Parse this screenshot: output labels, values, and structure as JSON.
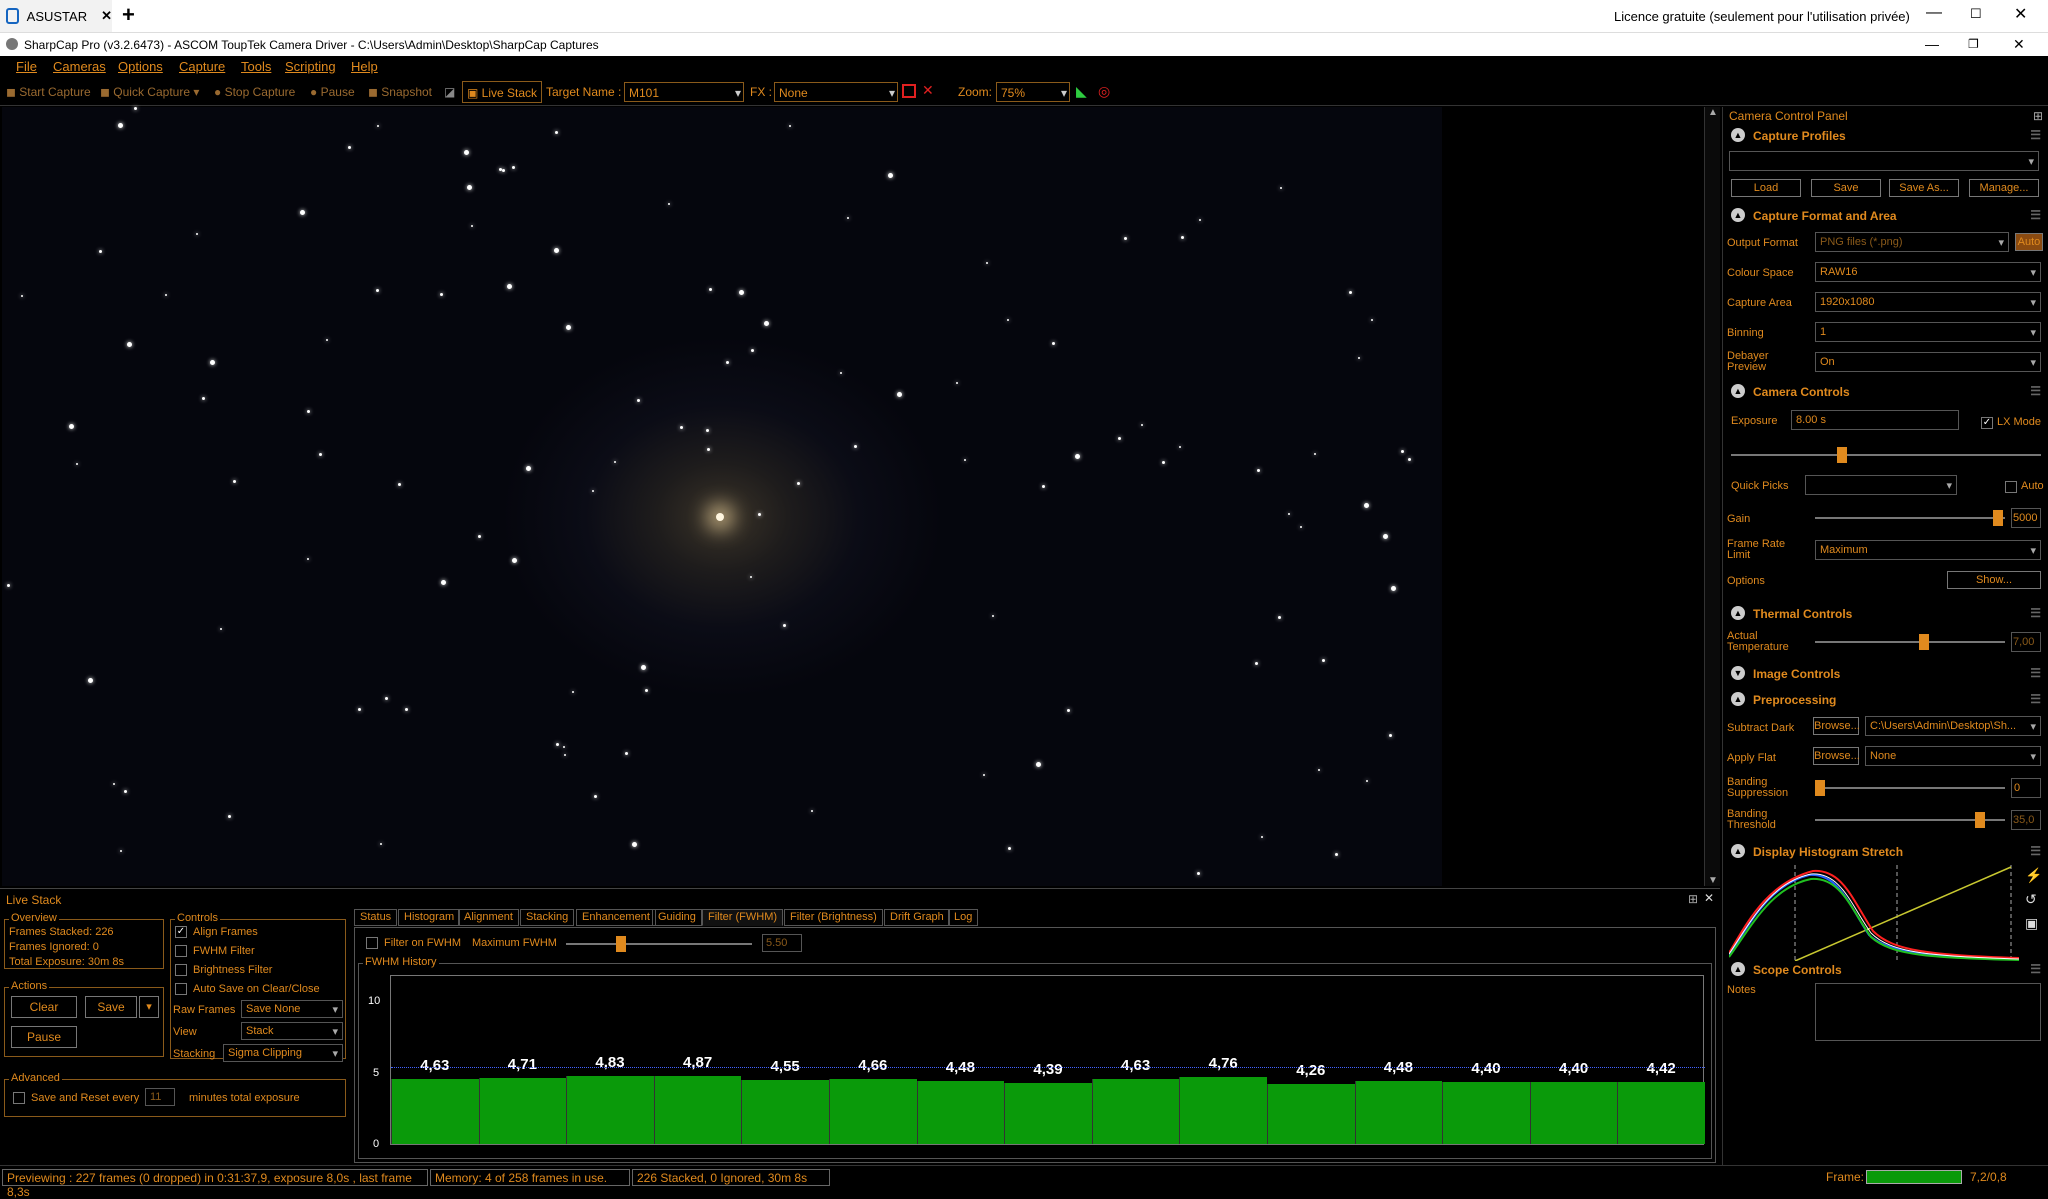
{
  "browser": {
    "tab_label": "ASUSTAR",
    "licence": "Licence gratuite (seulement pour l'utilisation privée)"
  },
  "window": {
    "title": "SharpCap Pro (v3.2.6473) - ASCOM ToupTek Camera Driver - C:\\Users\\Admin\\Desktop\\SharpCap Captures"
  },
  "menu": [
    "File",
    "Cameras",
    "Options",
    "Capture",
    "Tools",
    "Scripting",
    "Help"
  ],
  "toolbar": {
    "start_capture": "Start Capture",
    "quick_capture": "Quick Capture",
    "stop_capture": "Stop Capture",
    "pause": "Pause",
    "snapshot": "Snapshot",
    "live_stack": "Live Stack",
    "target_label": "Target Name :",
    "target_value": "M101",
    "fx_label": "FX :",
    "fx_value": "None",
    "zoom_label": "Zoom:",
    "zoom_value": "75%"
  },
  "right_panel": {
    "title": "Camera Control Panel",
    "capture_profiles": {
      "header": "Capture Profiles",
      "load": "Load",
      "save": "Save",
      "save_as": "Save As...",
      "manage": "Manage..."
    },
    "format": {
      "header": "Capture Format and Area",
      "output_format_label": "Output Format",
      "output_format": "PNG files (*.png)",
      "auto": "Auto",
      "colour_space_label": "Colour Space",
      "colour_space": "RAW16",
      "capture_area_label": "Capture Area",
      "capture_area": "1920x1080",
      "binning_label": "Binning",
      "binning": "1",
      "debayer_label": "Debayer Preview",
      "debayer": "On"
    },
    "camera": {
      "header": "Camera Controls",
      "exposure_label": "Exposure",
      "exposure": "8.00 s",
      "lx_mode": "LX Mode",
      "quick_picks_label": "Quick Picks",
      "quick_auto": "Auto",
      "gain_label": "Gain",
      "gain": "5000",
      "frame_rate_label": "Frame Rate Limit",
      "frame_rate": "Maximum",
      "options_label": "Options",
      "show": "Show..."
    },
    "thermal": {
      "header": "Thermal Controls",
      "temp_label": "Actual Temperature",
      "temp": "7,00"
    },
    "image_controls": {
      "header": "Image Controls"
    },
    "preprocessing": {
      "header": "Preprocessing",
      "dark_label": "Subtract Dark",
      "browse": "Browse...",
      "dark_path": "C:\\Users\\Admin\\Desktop\\Sh...",
      "flat_label": "Apply Flat",
      "flat": "None",
      "banding_supp_label": "Banding Suppression",
      "banding_supp": "0",
      "banding_thr_label": "Banding Threshold",
      "banding_thr": "35,0"
    },
    "histogram": {
      "header": "Display Histogram Stretch"
    },
    "scope": {
      "header": "Scope Controls",
      "notes_label": "Notes"
    }
  },
  "live_stack": {
    "title": "Live Stack",
    "overview": {
      "label": "Overview",
      "frames_stacked": "Frames Stacked:  226",
      "frames_ignored": "Frames Ignored:  0",
      "total_exposure": "Total Exposure:   30m 8s"
    },
    "actions": {
      "label": "Actions",
      "clear": "Clear",
      "save": "Save",
      "pause": "Pause"
    },
    "controls": {
      "label": "Controls",
      "align_frames": "Align Frames",
      "fwhm_filter": "FWHM Filter",
      "brightness_filter": "Brightness Filter",
      "auto_save": "Auto Save on Clear/Close",
      "raw_frames_label": "Raw Frames",
      "raw_frames": "Save None",
      "view_label": "View",
      "view": "Stack",
      "stacking_label": "Stacking",
      "stacking": "Sigma Clipping"
    },
    "advanced": {
      "label": "Advanced",
      "save_reset": "Save and Reset every",
      "minutes": "11",
      "minutes_label": "minutes total exposure"
    },
    "tabs": [
      "Status",
      "Histogram",
      "Alignment",
      "Stacking",
      "Enhancement",
      "Guiding",
      "Filter (FWHM)",
      "Filter (Brightness)",
      "Drift Graph",
      "Log"
    ],
    "filter": {
      "filter_on": "Filter on FWHM",
      "max_label": "Maximum FWHM",
      "max_value": "5.50",
      "history_label": "FWHM History"
    }
  },
  "chart_data": {
    "type": "bar",
    "values": [
      4.63,
      4.71,
      4.83,
      4.87,
      4.55,
      4.66,
      4.48,
      4.39,
      4.63,
      4.76,
      4.26,
      4.48,
      4.4,
      4.4,
      4.42
    ],
    "labels": [
      "4,63",
      "4,71",
      "4,83",
      "4,87",
      "4,55",
      "4,66",
      "4,48",
      "4,39",
      "4,63",
      "4,76",
      "4,26",
      "4,48",
      "4,40",
      "4,40",
      "4,42"
    ],
    "yticks": [
      "10",
      "5",
      "0"
    ],
    "ylim": [
      0,
      12
    ],
    "threshold": 5.5,
    "bar_color": "#0a9a0a"
  },
  "status": {
    "previewing": "Previewing : 227 frames (0 dropped) in 0:31:37,9, exposure 8,0s , last frame 8,3s",
    "memory": "Memory: 4 of 258 frames in use.",
    "stacked": "226 Stacked, 0 Ignored, 30m 8s",
    "frame_label": "Frame:",
    "frame_value": "7,2/0,8"
  },
  "colors": {
    "accent": "#e08a1e",
    "bar": "#0a9a0a"
  }
}
